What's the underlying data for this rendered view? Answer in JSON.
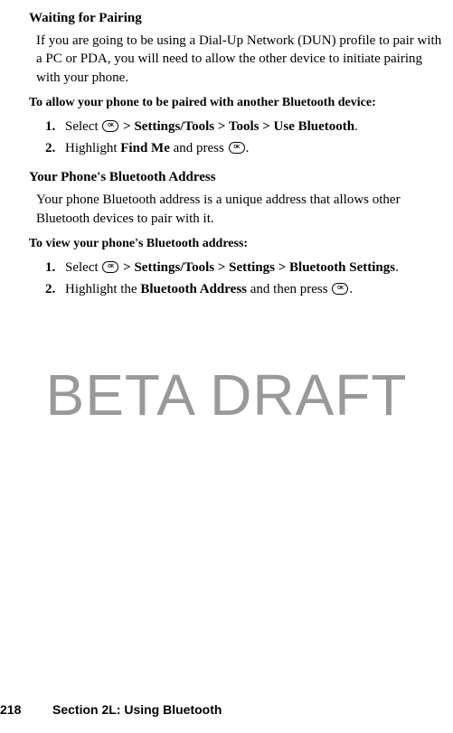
{
  "section1": {
    "heading": "Waiting for Pairing",
    "body": "If you are going to be using a Dial-Up Network (DUN) profile to pair with a PC or PDA, you will need to allow the other device to initiate pairing with your phone.",
    "instruction": "To allow your phone to be paired with another Bluetooth device:",
    "steps": [
      {
        "num": "1.",
        "pre": "Select ",
        "bold": " > Settings/Tools > Tools > Use Bluetooth",
        "post": "."
      },
      {
        "num": "2.",
        "pre": "Highlight ",
        "mid_bold": "Find Me",
        "mid": " and press ",
        "post": "."
      }
    ]
  },
  "section2": {
    "heading": "Your Phone's Bluetooth Address",
    "body": "Your phone Bluetooth address is a unique address that allows other Bluetooth devices to pair with it.",
    "instruction": "To view your phone's Bluetooth address:",
    "steps": [
      {
        "num": "1.",
        "pre": "Select ",
        "bold": " > Settings/Tools > Settings > Bluetooth Settings",
        "post": "."
      },
      {
        "num": "2.",
        "pre": "Highlight the ",
        "mid_bold": "Bluetooth Address",
        "mid": " and then press ",
        "post": "."
      }
    ]
  },
  "watermark": "BETA DRAFT",
  "footer": {
    "page": "218",
    "text": "Section 2L: Using Bluetooth"
  }
}
